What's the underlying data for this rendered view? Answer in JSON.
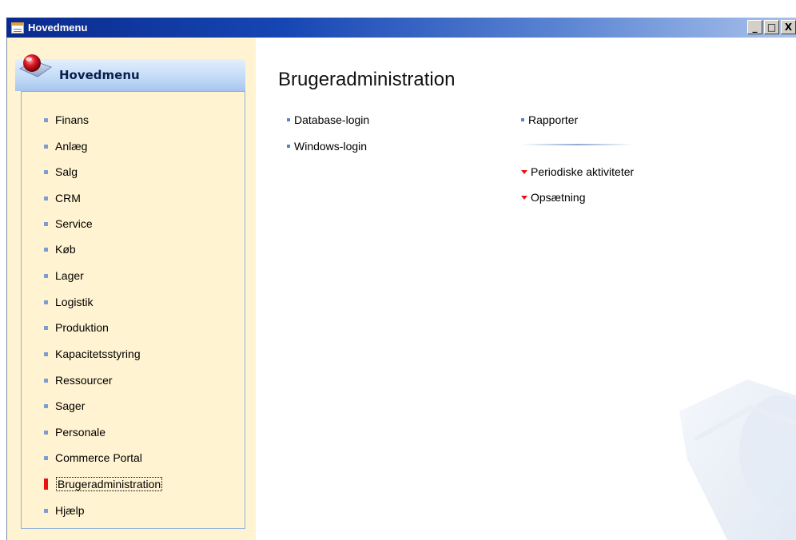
{
  "window": {
    "title": "Hovedmenu",
    "minimize": "_",
    "maximize": "□",
    "close": "X"
  },
  "nav": {
    "header": "Hovedmenu",
    "items": [
      {
        "label": "Finans",
        "active": false
      },
      {
        "label": "Anlæg",
        "active": false
      },
      {
        "label": "Salg",
        "active": false
      },
      {
        "label": "CRM",
        "active": false
      },
      {
        "label": "Service",
        "active": false
      },
      {
        "label": "Køb",
        "active": false
      },
      {
        "label": "Lager",
        "active": false
      },
      {
        "label": "Logistik",
        "active": false
      },
      {
        "label": "Produktion",
        "active": false
      },
      {
        "label": "Kapacitetsstyring",
        "active": false
      },
      {
        "label": "Ressourcer",
        "active": false
      },
      {
        "label": "Sager",
        "active": false
      },
      {
        "label": "Personale",
        "active": false
      },
      {
        "label": "Commerce Portal",
        "active": false
      },
      {
        "label": "Brugeradministration",
        "active": true
      },
      {
        "label": "Hjælp",
        "active": false
      }
    ]
  },
  "content": {
    "title": "Brugeradministration",
    "left_links": [
      "Database-login",
      "Windows-login"
    ],
    "right_links": [
      "Rapporter"
    ],
    "groups": [
      "Periodiske aktiviteter",
      "Opsætning"
    ]
  },
  "colors": {
    "titlebar": "#0a2a8c",
    "nav_background": "#fff3d1",
    "active_marker": "#e81010",
    "bullet": "#7b9ed2"
  }
}
